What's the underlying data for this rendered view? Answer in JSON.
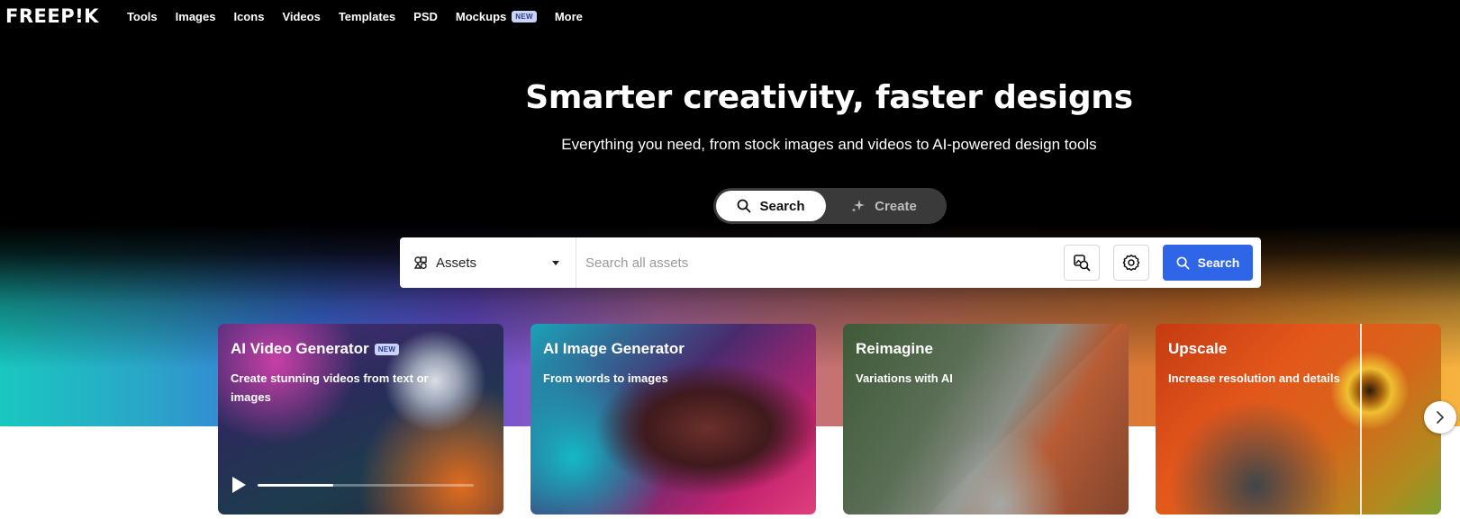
{
  "brand": {
    "logo_text": "FREEP!K"
  },
  "nav": {
    "items": [
      {
        "label": "Tools"
      },
      {
        "label": "Images"
      },
      {
        "label": "Icons"
      },
      {
        "label": "Videos"
      },
      {
        "label": "Templates"
      },
      {
        "label": "PSD"
      },
      {
        "label": "Mockups",
        "badge": "NEW"
      },
      {
        "label": "More"
      }
    ]
  },
  "hero": {
    "title": "Smarter creativity, faster designs",
    "subtitle": "Everything you need, from stock images and videos to AI-powered design tools"
  },
  "mode_toggle": {
    "search_label": "Search",
    "create_label": "Create",
    "active": "Search"
  },
  "search": {
    "asset_type": "Assets",
    "placeholder": "Search all assets",
    "value": "",
    "button_label": "Search"
  },
  "cards": [
    {
      "title": "AI Video Generator",
      "badge": "NEW",
      "description": "Create stunning videos from text or images",
      "video_progress": 0.35
    },
    {
      "title": "AI Image Generator",
      "description": "From words to images"
    },
    {
      "title": "Reimagine",
      "description": "Variations with AI"
    },
    {
      "title": "Upscale",
      "description": "Increase resolution and details"
    }
  ],
  "colors": {
    "primary_button": "#2f66e8",
    "badge_bg": "#c9d3f5",
    "hero_bg": "#000000"
  },
  "icons": {
    "search": "search-icon",
    "create": "sparkle-icon",
    "assets": "assets-icon",
    "image_search": "image-search-icon",
    "settings": "gear-icon",
    "next": "chevron-right-icon",
    "play": "play-icon"
  }
}
